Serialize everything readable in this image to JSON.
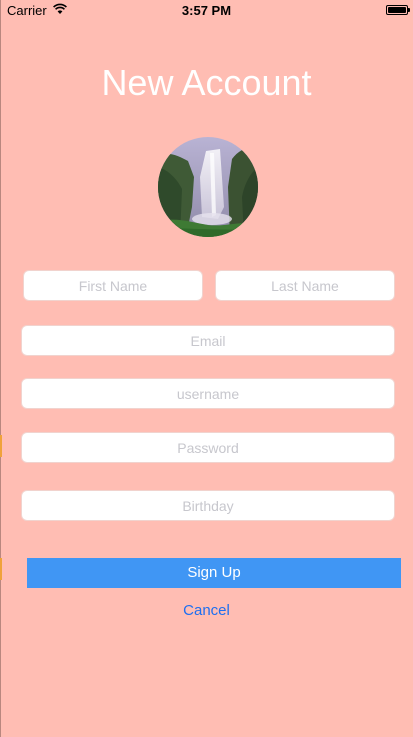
{
  "status_bar": {
    "carrier": "Carrier",
    "time": "3:57 PM",
    "wifi_icon": "wifi-icon",
    "battery_icon": "battery-icon"
  },
  "title": "New Account",
  "avatar": {
    "image": "waterfall photo"
  },
  "form": {
    "first_name_placeholder": "First Name",
    "last_name_placeholder": "Last Name",
    "email_placeholder": "Email",
    "username_placeholder": "username",
    "password_placeholder": "Password",
    "birthday_placeholder": "Birthday"
  },
  "buttons": {
    "signup_label": "Sign Up",
    "cancel_label": "Cancel"
  },
  "colors": {
    "background": "#ffbdb3",
    "signup_button": "#4096f4",
    "cancel_link": "#1e6ff0"
  }
}
